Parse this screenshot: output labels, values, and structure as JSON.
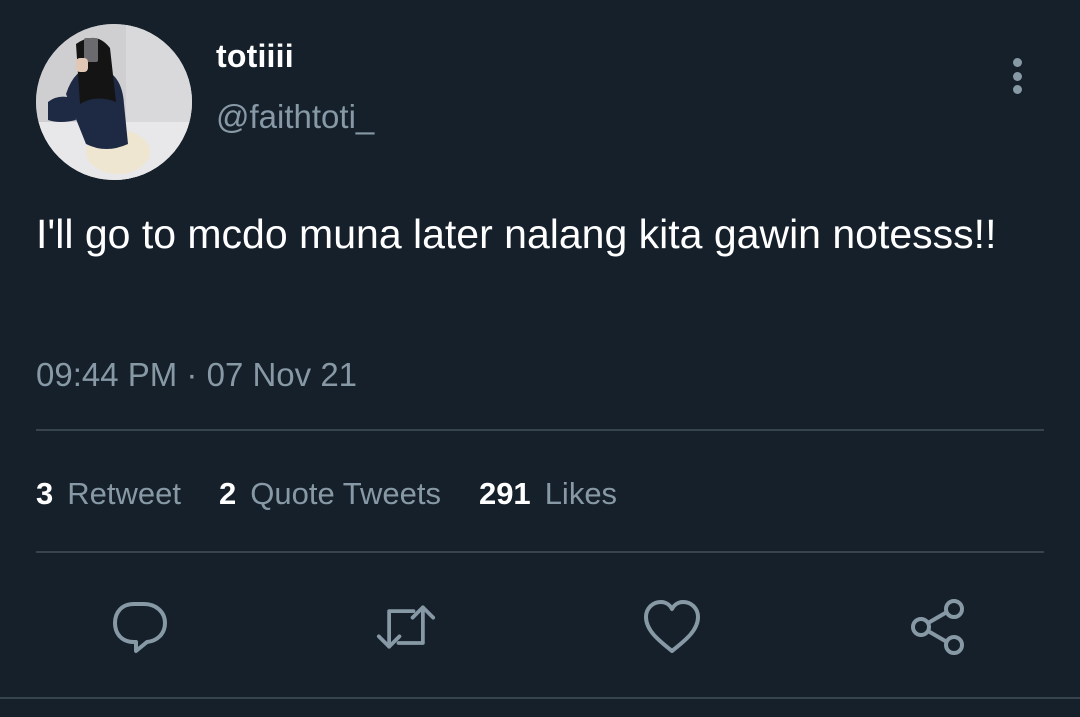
{
  "user": {
    "display_name": "totiiii",
    "handle": "@faithtoti_"
  },
  "tweet": {
    "text": "I'll go to mcdo muna later nalang kita gawin notesss!!",
    "time": "09:44 PM",
    "separator": "·",
    "date": "07 Nov 21"
  },
  "stats": {
    "retweets": {
      "count": "3",
      "label": "Retweet"
    },
    "quotes": {
      "count": "2",
      "label": "Quote Tweets"
    },
    "likes": {
      "count": "291",
      "label": "Likes"
    }
  },
  "actions": [
    "reply-icon",
    "retweet-icon",
    "like-icon",
    "share-icon"
  ],
  "colors": {
    "background": "#15202b",
    "secondary_text": "#8899a6",
    "divider": "#38444d",
    "primary_text": "#ffffff"
  }
}
